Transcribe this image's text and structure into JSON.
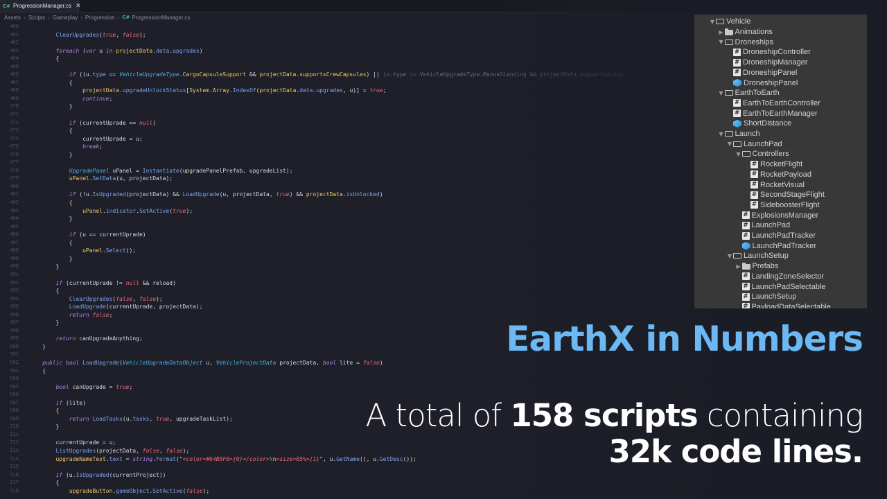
{
  "editor": {
    "tab_label": "ProgressionManager.cs",
    "tab_badge": "C#",
    "breadcrumb": [
      "Assets",
      "Scripts",
      "Gameplay",
      "Progression",
      "ProgressionManager.cs"
    ],
    "code_lines": [
      {
        "n": "460",
        "html": ""
      },
      {
        "n": "461",
        "html": "        <span class='fn'>ClearUpgrades</span>(<span class='lit'>true</span>, <span class='lit'>false</span>);"
      },
      {
        "n": "462",
        "html": ""
      },
      {
        "n": "463",
        "html": "        <span class='kw'>foreach</span> (<span class='kw'>var</span> u <span class='kw'>in</span> <span class='fy'>projectData</span>.<span class='fn'>data</span>.<span class='fn'>upgrades</span>)"
      },
      {
        "n": "464",
        "html": "        {"
      },
      {
        "n": "465",
        "html": ""
      },
      {
        "n": "466",
        "html": "            <span class='kw'>if</span> ((u.<span class='fn'>type</span> == <span class='ty'>VehicleUpgradeType</span>.<span class='fy'>CargoCapsuleSupport</span> &amp;&amp; <span class='fy'>projectData</span>.<span class='fy'>supportsCrewCapsules</span>) || <span class='dim'>(u.type == VehicleUpgradeType.ManualLanding &amp;&amp; projectData.supportsAutom</span>"
      },
      {
        "n": "467",
        "html": "            {"
      },
      {
        "n": "468",
        "html": "                <span class='fy'>projectData</span>.<span class='fn'>upgradeUnlockStatus</span>[<span class='fy'>System</span>.<span class='fy'>Array</span>.<span class='fn'>IndexOf</span>(<span class='fy'>projectData</span>.<span class='fn'>data</span>.<span class='fn'>upgrades</span>, u)] = <span class='lit'>true</span>;"
      },
      {
        "n": "469",
        "html": "                <span class='kw'>continue</span>;"
      },
      {
        "n": "470",
        "html": "            }"
      },
      {
        "n": "471",
        "html": ""
      },
      {
        "n": "472",
        "html": "            <span class='kw'>if</span> (currentUprade == <span class='lit'>null</span>)"
      },
      {
        "n": "473",
        "html": "            {"
      },
      {
        "n": "474",
        "html": "                currentUprade = u;"
      },
      {
        "n": "475",
        "html": "                <span class='kw'>break</span>;"
      },
      {
        "n": "476",
        "html": "            }"
      },
      {
        "n": "477",
        "html": ""
      },
      {
        "n": "478",
        "html": "            <span class='ty'>UpgradePanel</span> uPanel = <span class='fn'>Instantiate</span>(upgradePanelPrefab, upgradeList);"
      },
      {
        "n": "479",
        "html": "            <span class='fy'>uPanel</span>.<span class='fn'>SetData</span>(u, projectData);"
      },
      {
        "n": "480",
        "html": ""
      },
      {
        "n": "481",
        "html": "            <span class='kw'>if</span> (!u.<span class='fn'>IsUpgraded</span>(projectData) &amp;&amp; <span class='fn'>LoadUpgrade</span>(u, projectData, <span class='lit'>true</span>) &amp;&amp; <span class='fy'>projectData</span>.<span class='fn'>isUnlocked</span>)"
      },
      {
        "n": "482",
        "html": "            {"
      },
      {
        "n": "483",
        "html": "                <span class='fy'>uPanel</span>.<span class='fn'>indicator</span>.<span class='fn'>SetActive</span>(<span class='lit'>true</span>);"
      },
      {
        "n": "484",
        "html": "            }"
      },
      {
        "n": "485",
        "html": ""
      },
      {
        "n": "486",
        "html": "            <span class='kw'>if</span> (u == currentUprade)"
      },
      {
        "n": "487",
        "html": "            {"
      },
      {
        "n": "488",
        "html": "                <span class='fy'>uPanel</span>.<span class='fn'>Select</span>();"
      },
      {
        "n": "489",
        "html": "            }"
      },
      {
        "n": "490",
        "html": "        }"
      },
      {
        "n": "491",
        "html": ""
      },
      {
        "n": "492",
        "html": "        <span class='kw'>if</span> (currentUprade != <span class='lit'>null</span> &amp;&amp; reload)"
      },
      {
        "n": "493",
        "html": "        {"
      },
      {
        "n": "494",
        "html": "            <span class='fn'>ClearUpgrades</span>(<span class='lit'>false</span>, <span class='lit'>false</span>);"
      },
      {
        "n": "495",
        "html": "            <span class='fn'>LoadUpgrade</span>(currentUprade, projectData);"
      },
      {
        "n": "496",
        "html": "            <span class='kw'>return</span> <span class='lit'>false</span>;"
      },
      {
        "n": "497",
        "html": "        }"
      },
      {
        "n": "498",
        "html": ""
      },
      {
        "n": "499",
        "html": "        <span class='kw'>return</span> canUpgradeAnything;"
      },
      {
        "n": "500",
        "html": "    }"
      },
      {
        "n": "501",
        "html": ""
      },
      {
        "n": "502",
        "html": "    <span class='kw'>public</span> <span class='kw'>bool</span> <span class='fn'>LoadUpgrade</span>(<span class='ty'>VehicleUpgradeDataObject</span> u, <span class='ty'>VehicleProjectData</span> projectData, <span class='kw'>bool</span> lite = <span class='lit'>false</span>)"
      },
      {
        "n": "503",
        "html": "    {"
      },
      {
        "n": "504",
        "html": ""
      },
      {
        "n": "505",
        "html": "        <span class='kw'>bool</span> canUpgrade = <span class='lit'>true</span>;"
      },
      {
        "n": "506",
        "html": ""
      },
      {
        "n": "507",
        "html": "        <span class='kw'>if</span> (lite)"
      },
      {
        "n": "508",
        "html": "        {"
      },
      {
        "n": "509",
        "html": "            <span class='kw'>return</span> <span class='fn'>LoadTasks</span>(u.<span class='fn'>tasks</span>, <span class='lit'>true</span>, upgradeTaskList);"
      },
      {
        "n": "510",
        "html": "        }"
      },
      {
        "n": "511",
        "html": ""
      },
      {
        "n": "512",
        "html": "        currentUprade = u;"
      },
      {
        "n": "513",
        "html": "        <span class='fn'>ListUpgrades</span>(projectData, <span class='lit'>false</span>, <span class='lit'>false</span>);"
      },
      {
        "n": "514",
        "html": "        <span class='fy'>upgradeNameText</span>.<span class='fn'>text</span> = <span class='kw'>string</span>.<span class='fn'>Format</span>(<span class='str'>\"<span class='lit'>&lt;color=#64B5F6&gt;{0}&lt;/color&gt;</span>\\n<span class='lit'>&lt;size=85%&gt;{1}</span>\"</span>, u.<span class='fn'>GetName</span>(), u.<span class='fn'>GetDesc</span>());"
      },
      {
        "n": "515",
        "html": ""
      },
      {
        "n": "516",
        "html": "        <span class='kw'>if</span> (u.<span class='fn'>IsUpgraded</span>(currentProject))"
      },
      {
        "n": "517",
        "html": "        {"
      },
      {
        "n": "518",
        "html": "            <span class='fy'>upgradeButton</span>.<span class='fn'>gameObject</span>.<span class='fn'>SetActive</span>(<span class='lit'>false</span>);"
      }
    ]
  },
  "hierarchy": {
    "items": [
      {
        "label": "Vehicle",
        "type": "openfolder",
        "depth": 0,
        "arrow": "open"
      },
      {
        "label": "Animations",
        "type": "folder",
        "depth": 1,
        "arrow": "closed"
      },
      {
        "label": "Droneships",
        "type": "openfolder",
        "depth": 1,
        "arrow": "open"
      },
      {
        "label": "DroneshipController",
        "type": "script",
        "depth": 2,
        "arrow": "none"
      },
      {
        "label": "DroneshipManager",
        "type": "script",
        "depth": 2,
        "arrow": "none"
      },
      {
        "label": "DroneshipPanel",
        "type": "script",
        "depth": 2,
        "arrow": "none"
      },
      {
        "label": "DroneshipPanel",
        "type": "prefab",
        "depth": 2,
        "arrow": "none"
      },
      {
        "label": "EarthToEarth",
        "type": "openfolder",
        "depth": 1,
        "arrow": "open"
      },
      {
        "label": "EarthToEarthController",
        "type": "script",
        "depth": 2,
        "arrow": "none"
      },
      {
        "label": "EarthToEarthManager",
        "type": "script",
        "depth": 2,
        "arrow": "none"
      },
      {
        "label": "ShortDistance",
        "type": "prefab",
        "depth": 2,
        "arrow": "none"
      },
      {
        "label": "Launch",
        "type": "openfolder",
        "depth": 1,
        "arrow": "open"
      },
      {
        "label": "LaunchPad",
        "type": "openfolder",
        "depth": 2,
        "arrow": "open"
      },
      {
        "label": "Controllers",
        "type": "openfolder",
        "depth": 3,
        "arrow": "open"
      },
      {
        "label": "RocketFlight",
        "type": "script",
        "depth": 4,
        "arrow": "none"
      },
      {
        "label": "RocketPayload",
        "type": "script",
        "depth": 4,
        "arrow": "none"
      },
      {
        "label": "RocketVisual",
        "type": "script",
        "depth": 4,
        "arrow": "none"
      },
      {
        "label": "SecondStageFlight",
        "type": "script",
        "depth": 4,
        "arrow": "none"
      },
      {
        "label": "SideboosterFlight",
        "type": "script",
        "depth": 4,
        "arrow": "none"
      },
      {
        "label": "ExplosionsManager",
        "type": "script",
        "depth": 3,
        "arrow": "none"
      },
      {
        "label": "LaunchPad",
        "type": "script",
        "depth": 3,
        "arrow": "none"
      },
      {
        "label": "LaunchPadTracker",
        "type": "script",
        "depth": 3,
        "arrow": "none"
      },
      {
        "label": "LaunchPadTracker",
        "type": "prefab",
        "depth": 3,
        "arrow": "none"
      },
      {
        "label": "LaunchSetup",
        "type": "openfolder",
        "depth": 2,
        "arrow": "open"
      },
      {
        "label": "Prefabs",
        "type": "folder",
        "depth": 3,
        "arrow": "closed"
      },
      {
        "label": "LandingZoneSelector",
        "type": "script",
        "depth": 3,
        "arrow": "none"
      },
      {
        "label": "LaunchPadSelectable",
        "type": "script",
        "depth": 3,
        "arrow": "none"
      },
      {
        "label": "LaunchSetup",
        "type": "script",
        "depth": 3,
        "arrow": "none"
      },
      {
        "label": "PayloadDataSelectable",
        "type": "script",
        "depth": 3,
        "arrow": "none"
      }
    ]
  },
  "overlay": {
    "headline": "EarthX in Numbers",
    "stat_line1_pre": "A total of ",
    "stat_line1_bold": "158 scripts",
    "stat_line1_post": " containing",
    "stat_line2_bold": "32k code lines."
  },
  "colors": {
    "headline": "#6cb8f3",
    "panel": "#383838",
    "editor_bg": "#1e1f29"
  }
}
